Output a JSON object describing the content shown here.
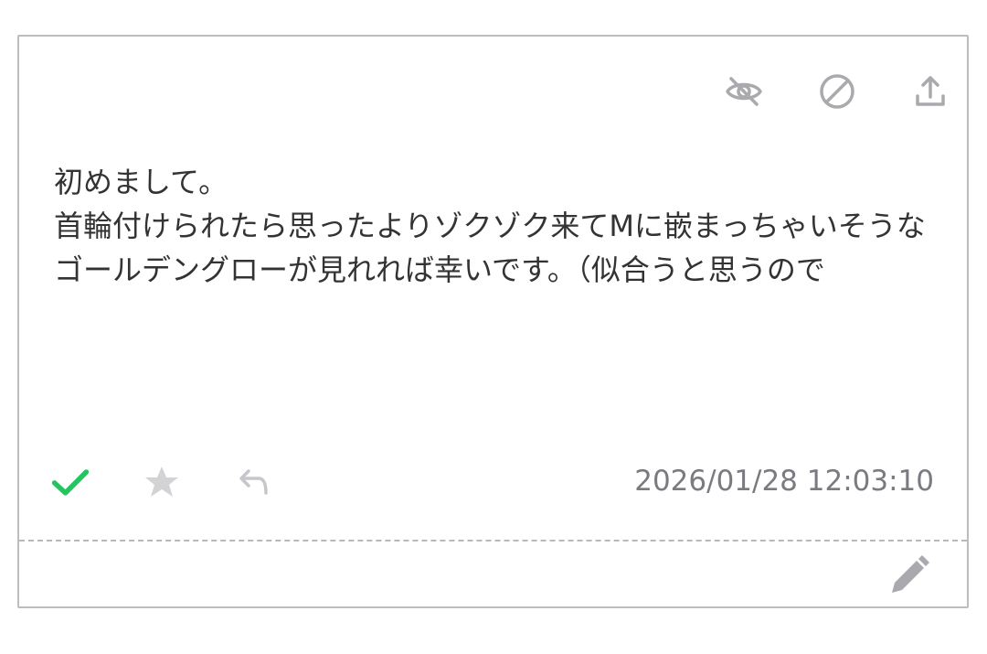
{
  "message": {
    "text": "初めまして。\n首輪付けられたら思ったよりゾクゾク来てMに嵌まっちゃいそうなゴールデングローが見れれば幸いです。（似合うと思うので"
  },
  "meta": {
    "timestamp": "2026/01/28 12:03:10"
  },
  "icons": {
    "hide": "eye-off-icon",
    "block": "block-icon",
    "share": "share-upload-icon",
    "check": "check-icon",
    "star": "star-icon",
    "reply": "reply-icon",
    "edit": "pencil-icon"
  },
  "colors": {
    "check": "#22c55e",
    "icon_gray": "#a9a9ae",
    "star_gray": "#d3d3d6"
  }
}
